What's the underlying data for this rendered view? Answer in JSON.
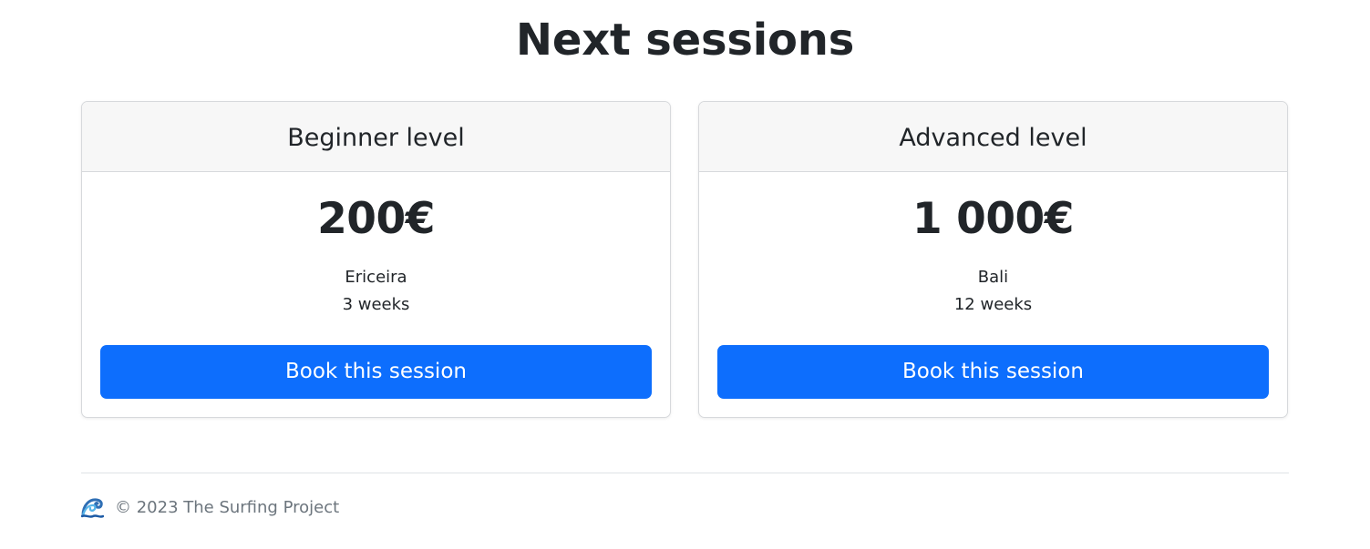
{
  "page": {
    "title": "Next sessions"
  },
  "sessions": [
    {
      "level": "Beginner level",
      "price": "200€",
      "location": "Ericeira",
      "duration": "3 weeks",
      "button_label": "Book this session"
    },
    {
      "level": "Advanced level",
      "price": "1 000€",
      "location": "Bali",
      "duration": "12 weeks",
      "button_label": "Book this session"
    }
  ],
  "footer": {
    "icon": "water-wave-icon",
    "copyright": "© 2023 The Surfing Project"
  },
  "colors": {
    "primary_button": "#0d6efd",
    "card_header_bg": "#f7f7f7",
    "muted_text": "#6c757d"
  }
}
